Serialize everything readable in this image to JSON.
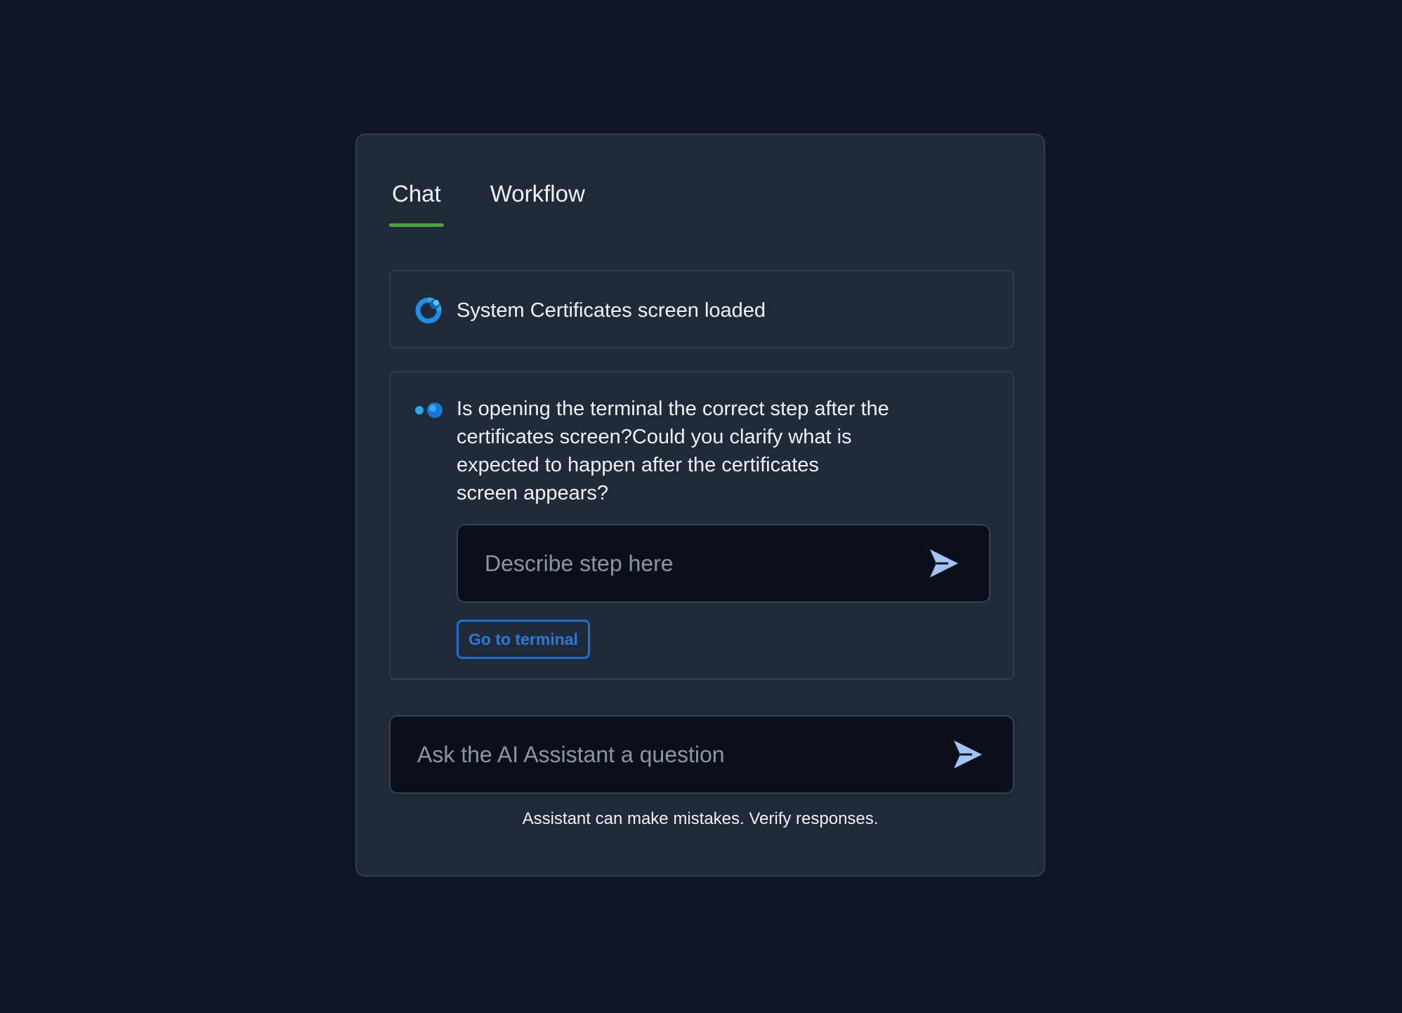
{
  "tabs": [
    {
      "label": "Chat",
      "active": true
    },
    {
      "label": "Workflow",
      "active": false
    }
  ],
  "status": {
    "icon": "assistant-logo-icon",
    "text": "System Certificates screen loaded"
  },
  "question": {
    "icon": "typing-dots-icon",
    "text": "Is opening the terminal the correct step after the\ncertificates screen?Could you clarify what is\nexpected to happen after the certificates\nscreen appears?",
    "input_placeholder": "Describe step here",
    "input_value": "",
    "send_icon": "send-icon",
    "action_label": "Go to terminal"
  },
  "ask": {
    "placeholder": "Ask the AI Assistant a question",
    "value": "",
    "send_icon": "send-icon"
  },
  "disclaimer": "Assistant can make mistakes. Verify responses.",
  "colors": {
    "background": "#0f1626",
    "panel": "#202938",
    "active_tab_underline": "#4aa535",
    "send_icon": "#9fc4f5",
    "action_button": "#1f6fd1"
  }
}
